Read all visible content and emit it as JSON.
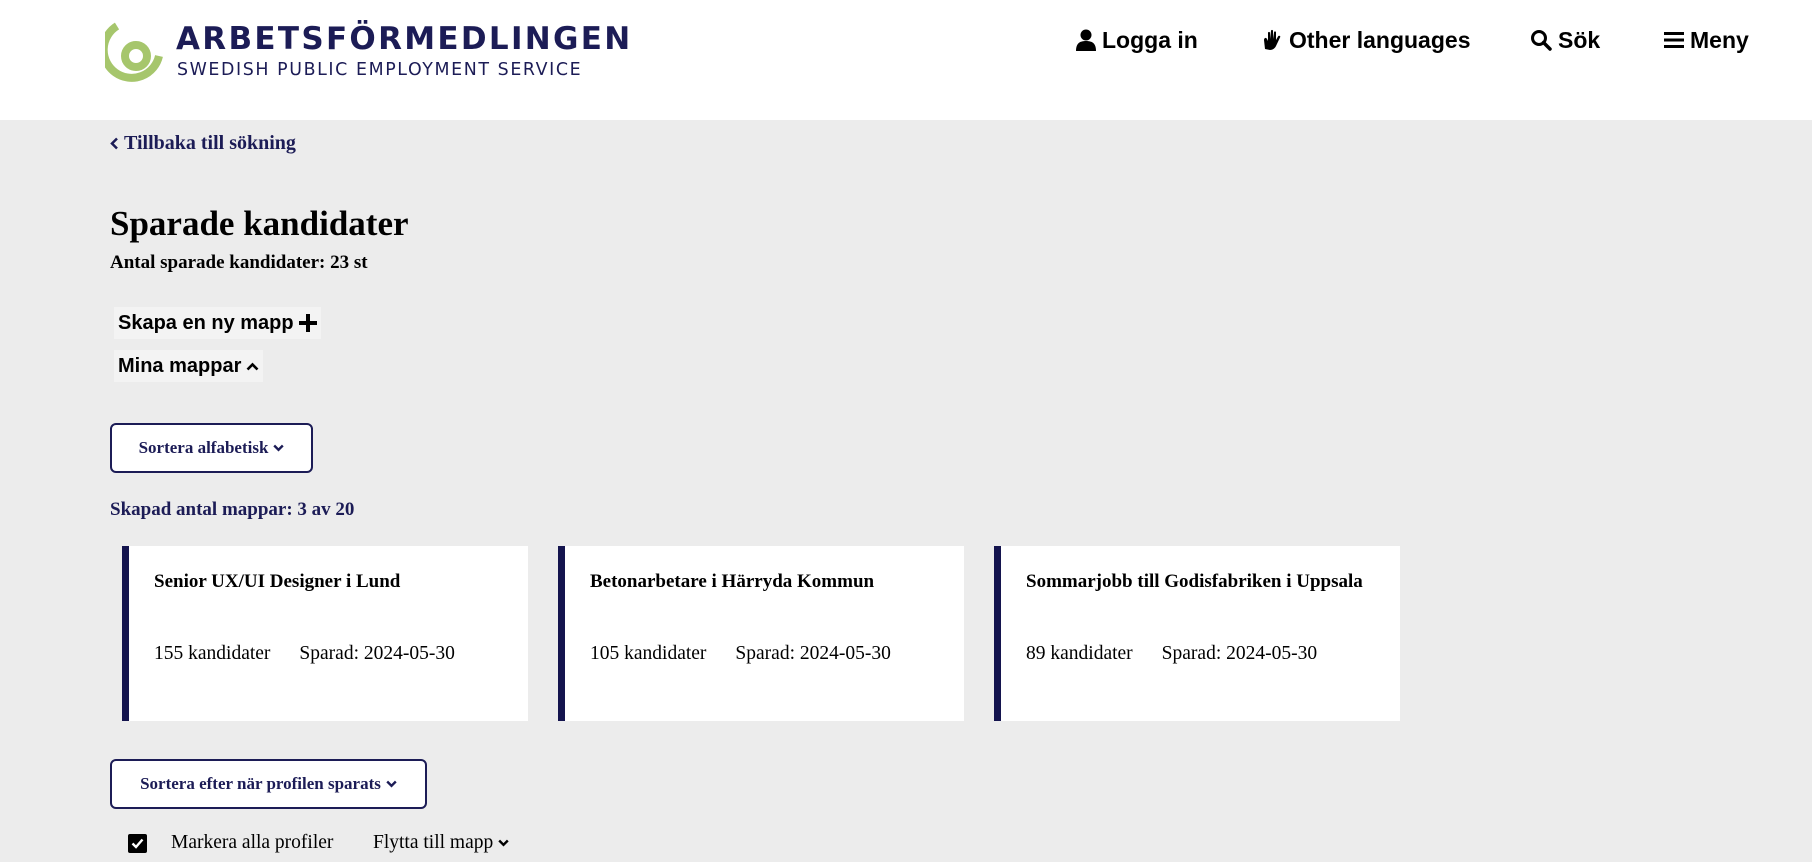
{
  "header": {
    "logo": {
      "title": "ARBETSFÖRMEDLINGEN",
      "subtitle": "SWEDISH PUBLIC EMPLOYMENT SERVICE"
    },
    "nav": {
      "login": "Logga in",
      "languages": "Other languages",
      "search": "Sök",
      "menu": "Meny"
    }
  },
  "back_link": "Tillbaka till sökning",
  "page": {
    "title": "Sparade kandidater",
    "saved_count": "Antal sparade kandidater: 23 st"
  },
  "actions": {
    "create_folder": "Skapa en ny mapp",
    "my_folders": "Mina mappar"
  },
  "folder_sort": "Sortera alfabetisk",
  "folder_count": "Skapad antal mappar: 3 av 20",
  "folders": [
    {
      "title": "Senior UX/UI Designer i Lund",
      "candidates": "155 kandidater",
      "saved": "Sparad: 2024-05-30"
    },
    {
      "title": "Betonarbetare i Härryda Kommun",
      "candidates": "105 kandidater",
      "saved": "Sparad: 2024-05-30"
    },
    {
      "title": "Sommarjobb till Godisfabriken i Uppsala",
      "candidates": "89 kandidater",
      "saved": "Sparad: 2024-05-30"
    }
  ],
  "profile_sort": "Sortera efter när profilen sparats",
  "bulk": {
    "mark_all": "Markera alla profiler",
    "mark_all_checked": true,
    "move_to": "Flytta till mapp"
  },
  "colors": {
    "navy": "#1c1c56",
    "logo_green": "#a6c66c",
    "background": "#ececec"
  },
  "icons": [
    "user-icon",
    "sign-language-icon",
    "search-icon",
    "menu-icon",
    "chevron-left-icon",
    "plus-icon",
    "chevron-up-icon",
    "chevron-down-icon",
    "check-icon"
  ]
}
